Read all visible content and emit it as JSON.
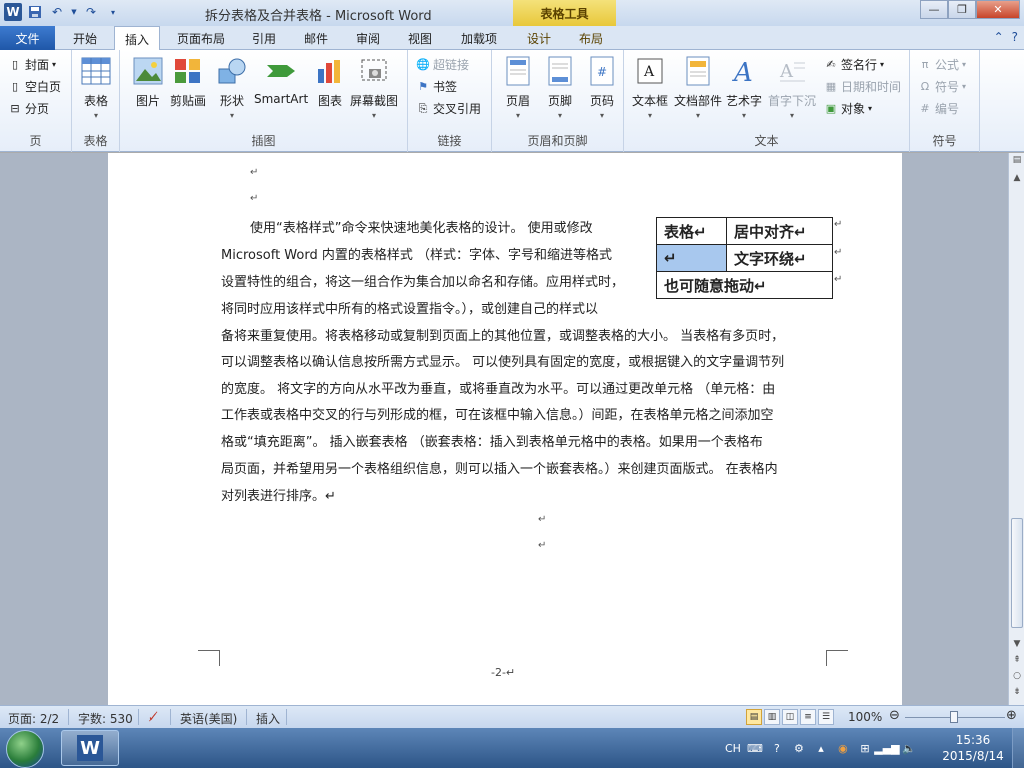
{
  "window": {
    "title": "拆分表格及合并表格 - Microsoft Word",
    "contextual_tab_group": "表格工具"
  },
  "tabs": [
    {
      "label": "文件"
    },
    {
      "label": "开始"
    },
    {
      "label": "插入"
    },
    {
      "label": "页面布局"
    },
    {
      "label": "引用"
    },
    {
      "label": "邮件"
    },
    {
      "label": "审阅"
    },
    {
      "label": "视图"
    },
    {
      "label": "加载项"
    },
    {
      "label": "设计"
    },
    {
      "label": "布局"
    }
  ],
  "ribbon": {
    "page_group": {
      "label": "页",
      "items": [
        "封面",
        "空白页",
        "分页"
      ]
    },
    "table_group": {
      "label": "表格",
      "table": "表格"
    },
    "illustrations": {
      "label": "插图",
      "items": [
        "图片",
        "剪贴画",
        "形状",
        "SmartArt",
        "图表",
        "屏幕截图"
      ]
    },
    "links": {
      "label": "链接",
      "items": [
        "超链接",
        "书签",
        "交叉引用"
      ]
    },
    "header_footer": {
      "label": "页眉和页脚",
      "items": [
        "页眉",
        "页脚",
        "页码"
      ]
    },
    "text": {
      "label": "文本",
      "items": [
        "文本框",
        "文档部件",
        "艺术字",
        "首字下沉"
      ],
      "small": [
        "签名行",
        "日期和时间",
        "对象"
      ]
    },
    "symbols": {
      "label": "符号",
      "items": [
        "公式",
        "符号",
        "编号"
      ]
    }
  },
  "document": {
    "lines": [
      "使用“表格样式”命令来快速地美化表格的设计。 使用或修改",
      "Microsoft Word 内置的表格样式 （样式：字体、字号和缩进等格式",
      "设置特性的组合，将这一组合作为集合加以命名和存储。应用样式时，",
      "将同时应用该样式中所有的格式设置指令。），或创建自己的样式以",
      "备将来重复使用。将表格移动或复制到页面上的其他位置，或调整表格的大小。 当表格有多页时，",
      "可以调整表格以确认信息按所需方式显示。 可以使列具有固定的宽度，或根据键入的文字量调节列",
      "的宽度。  将文字的方向从水平改为垂直，或将垂直改为水平。可以通过更改单元格 （单元格：由",
      "工作表或表格中交叉的行与列形成的框，可在该框中输入信息。）间距，在表格单元格之间添加空",
      "格或“填充距离”。 插入嵌套表格 （嵌套表格：插入到表格单元格中的表格。如果用一个表格布",
      "局页面，并希望用另一个表格组织信息，则可以插入一个嵌套表格。）来创建页面版式。 在表格内",
      "对列表进行排序。↵"
    ],
    "table": {
      "r1c1": "表格↵",
      "r1c2": "居中对齐↵",
      "r2c1": "↵",
      "r2c2": "文字环绕↵",
      "r3": "也可随意拖动↵"
    },
    "para_mark": "↵",
    "page_number": "-2-↵"
  },
  "statusbar": {
    "page": "页面: 2/2",
    "words": "字数: 530",
    "language": "英语(美国)",
    "mode": "插入",
    "zoom": "100%"
  },
  "taskbar": {
    "lang": "CH",
    "time": "15:36",
    "date": "2015/8/14"
  }
}
